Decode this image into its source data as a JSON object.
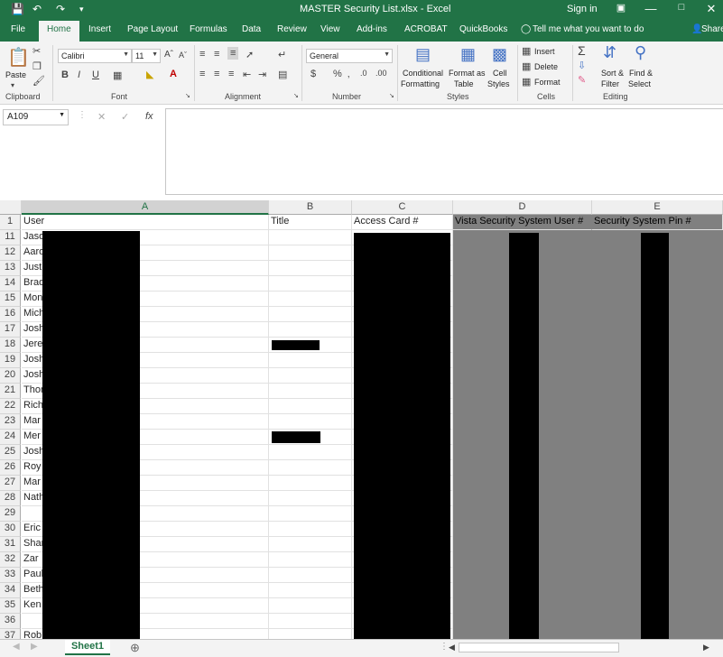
{
  "window": {
    "title": "MASTER Security List.xlsx - Excel",
    "sign_in": "Sign in",
    "accent": "#217346"
  },
  "tabs": [
    "File",
    "Home",
    "Insert",
    "Page Layout",
    "Formulas",
    "Data",
    "Review",
    "View",
    "Add-ins",
    "ACROBAT",
    "QuickBooks"
  ],
  "active_tab": "Home",
  "tell_me": "Tell me what you want to do",
  "share": "Share",
  "ribbon": {
    "clipboard": {
      "label": "Clipboard",
      "paste": "Paste"
    },
    "font": {
      "label": "Font",
      "name": "Calibri",
      "size": "11"
    },
    "alignment": {
      "label": "Alignment"
    },
    "number": {
      "label": "Number",
      "format": "General"
    },
    "styles": {
      "label": "Styles",
      "conditional": "Conditional",
      "formatting": "Formatting",
      "format_as": "Format as",
      "table": "Table",
      "cell": "Cell",
      "cell_styles": "Styles"
    },
    "cells": {
      "label": "Cells",
      "insert": "Insert",
      "delete": "Delete",
      "format": "Format"
    },
    "editing": {
      "label": "Editing",
      "sort": "Sort &",
      "filter": "Filter",
      "find": "Find &",
      "select": "Select"
    }
  },
  "formula_bar": {
    "name_box": "A109",
    "value": ""
  },
  "columns": [
    "A",
    "B",
    "C",
    "D",
    "E"
  ],
  "header_row": {
    "num": "1",
    "A": "User",
    "B": "Title",
    "C": "Access Card #",
    "D": "Vista Security System User #",
    "E": "Security System Pin #"
  },
  "rows": [
    {
      "num": "11",
      "user": "Jaso"
    },
    {
      "num": "12",
      "user": "Aaro"
    },
    {
      "num": "13",
      "user": "Just"
    },
    {
      "num": "14",
      "user": "Brad"
    },
    {
      "num": "15",
      "user": "Mon"
    },
    {
      "num": "16",
      "user": "Mich"
    },
    {
      "num": "17",
      "user": "Josh"
    },
    {
      "num": "18",
      "user": "Jere"
    },
    {
      "num": "19",
      "user": "Josh"
    },
    {
      "num": "20",
      "user": "Josh"
    },
    {
      "num": "21",
      "user": "Thor"
    },
    {
      "num": "22",
      "user": "Rich"
    },
    {
      "num": "23",
      "user": "Mar"
    },
    {
      "num": "24",
      "user": "Mer"
    },
    {
      "num": "25",
      "user": "Josh"
    },
    {
      "num": "26",
      "user": "Roy"
    },
    {
      "num": "27",
      "user": "Mar"
    },
    {
      "num": "28",
      "user": "Nath"
    },
    {
      "num": "29",
      "user": ""
    },
    {
      "num": "30",
      "user": "Eric"
    },
    {
      "num": "31",
      "user": "Shar"
    },
    {
      "num": "32",
      "user": "Zar"
    },
    {
      "num": "33",
      "user": "Paul"
    },
    {
      "num": "34",
      "user": "Beth"
    },
    {
      "num": "35",
      "user": "Ken"
    },
    {
      "num": "36",
      "user": ""
    },
    {
      "num": "37",
      "user": "Rob"
    }
  ],
  "sheet_tab": "Sheet1"
}
